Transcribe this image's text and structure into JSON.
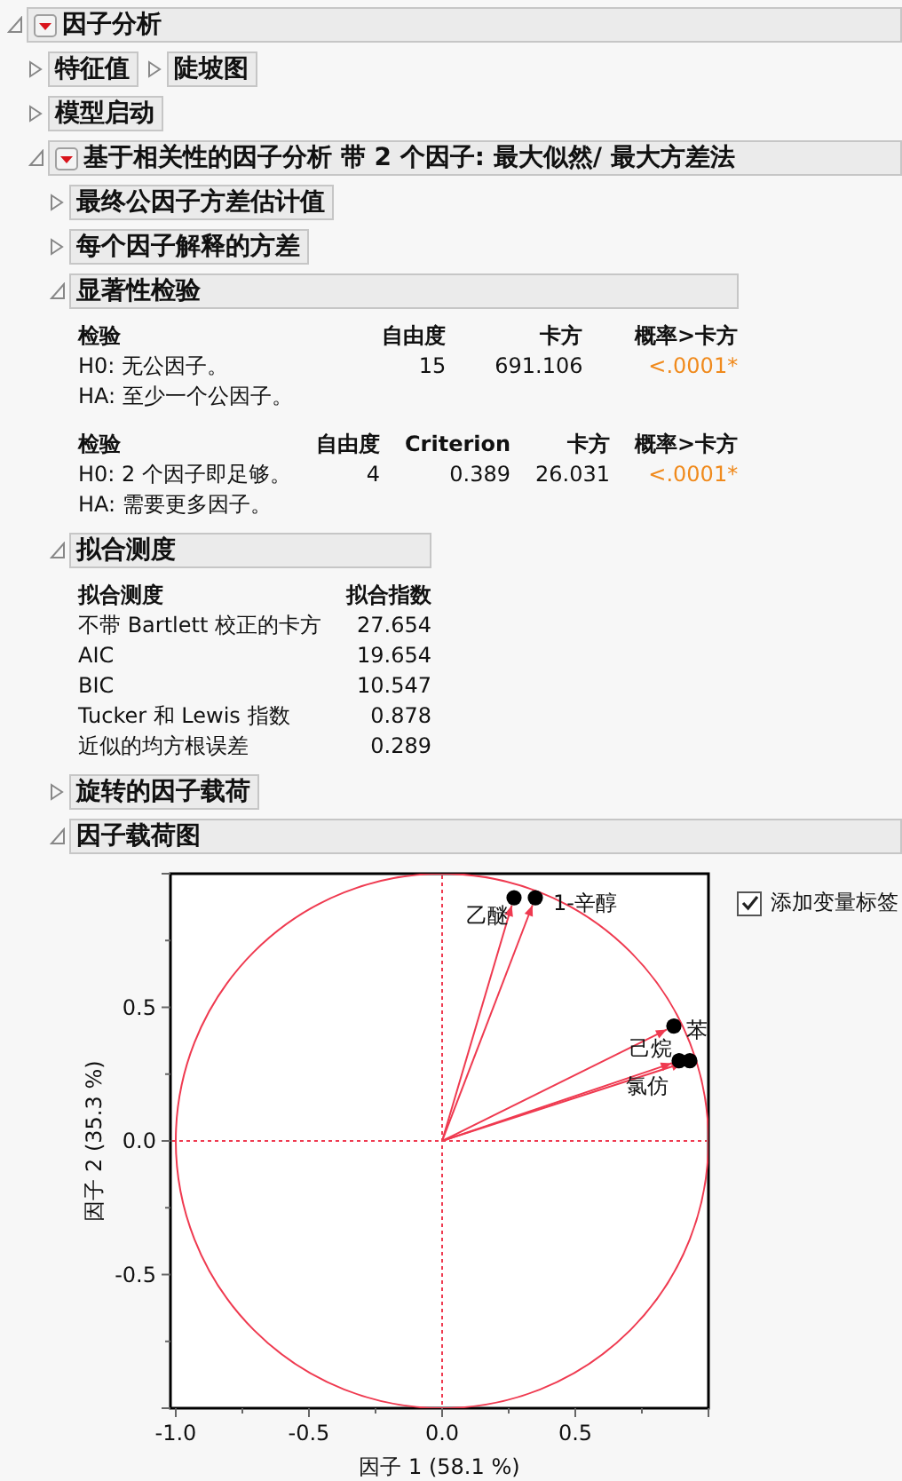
{
  "report": {
    "kind": "node",
    "title": "因子分析",
    "expanded": true,
    "menu": true,
    "children": [
      {
        "kind": "row",
        "nodes": [
          {
            "kind": "node",
            "title": "特征值",
            "expanded": false
          },
          {
            "kind": "node",
            "title": "陡坡图",
            "expanded": false
          }
        ]
      },
      {
        "kind": "node",
        "title": "模型启动",
        "expanded": false
      },
      {
        "kind": "node",
        "title": "基于相关性的因子分析 带 2 个因子: 最大似然/ 最大方差法",
        "expanded": true,
        "menu": true,
        "children": [
          {
            "kind": "node",
            "title": "最终公因子方差估计值",
            "expanded": false
          },
          {
            "kind": "node",
            "title": "每个因子解释的方差",
            "expanded": false
          },
          {
            "kind": "node",
            "title": "显著性检验",
            "expanded": true,
            "tables": [
              {
                "columns": [
                  "检验",
                  "自由度",
                  "卡方",
                  "概率>卡方"
                ],
                "rows": [
                  {
                    "cells": [
                      "H0: 无公因子。",
                      "15",
                      "691.106",
                      "<.0001*"
                    ],
                    "significant": true
                  },
                  {
                    "cells": [
                      "HA: 至少一个公因子。"
                    ]
                  }
                ]
              },
              {
                "columns": [
                  "检验",
                  "自由度",
                  "Criterion",
                  "卡方",
                  "概率>卡方"
                ],
                "rows": [
                  {
                    "cells": [
                      "H0: 2 个因子即足够。",
                      "4",
                      "0.389",
                      "26.031",
                      "<.0001*"
                    ],
                    "significant": true
                  },
                  {
                    "cells": [
                      "HA: 需要更多因子。"
                    ]
                  }
                ]
              }
            ]
          },
          {
            "kind": "node",
            "title": "拟合测度",
            "expanded": true,
            "tables": [
              {
                "columns": [
                  "拟合测度",
                  "拟合指数"
                ],
                "rows": [
                  {
                    "cells": [
                      "不带 Bartlett 校正的卡方",
                      "27.654"
                    ]
                  },
                  {
                    "cells": [
                      "AIC",
                      "19.654"
                    ]
                  },
                  {
                    "cells": [
                      "BIC",
                      "10.547"
                    ]
                  },
                  {
                    "cells": [
                      "Tucker 和 Lewis 指数",
                      "0.878"
                    ]
                  },
                  {
                    "cells": [
                      "近似的均方根误差",
                      "0.289"
                    ]
                  }
                ]
              }
            ]
          },
          {
            "kind": "node",
            "title": "旋转的因子载荷",
            "expanded": false
          },
          {
            "kind": "node",
            "title": "因子载荷图",
            "expanded": true,
            "plot": {
              "checkbox": {
                "label": "添加变量标签",
                "checked": true
              },
              "chart_data": {
                "type": "scatter",
                "xlabel": "因子 1  (58.1 %)",
                "ylabel": "因子 2  (35.3 %)",
                "x": [
                  0.27,
                  0.35,
                  0.87,
                  0.89,
                  0.93
                ],
                "series": [
                  {
                    "color": "#000000",
                    "values": [
                      0.91,
                      0.91,
                      0.43,
                      0.3,
                      0.3
                    ]
                  }
                ],
                "annotations": [
                  {
                    "text": "乙醚",
                    "x": 0.27,
                    "y": 0.91
                  },
                  {
                    "text": "1-辛醇",
                    "x": 0.35,
                    "y": 0.91
                  },
                  {
                    "text": "苯",
                    "x": 0.87,
                    "y": 0.43
                  },
                  {
                    "text": "己烷",
                    "x": 0.89,
                    "y": 0.3
                  },
                  {
                    "text": "氯仿",
                    "x": 0.93,
                    "y": 0.3
                  }
                ],
                "xlim": [
                  -1.02,
                  1.0
                ],
                "ylim": [
                  -1.0,
                  1.0
                ],
                "xticks": [
                  {
                    "value": -1,
                    "label": "-1.0"
                  },
                  {
                    "value": -0.5,
                    "label": "-0.5"
                  },
                  {
                    "value": 0,
                    "label": "0.0"
                  },
                  {
                    "value": 0.5,
                    "label": "0.5"
                  }
                ],
                "yticks": [
                  {
                    "value": 0.5,
                    "label": "0.5"
                  },
                  {
                    "value": 0,
                    "label": "0.0"
                  },
                  {
                    "value": -0.5,
                    "label": "-0.5"
                  }
                ]
              }
            }
          }
        ]
      }
    ]
  }
}
